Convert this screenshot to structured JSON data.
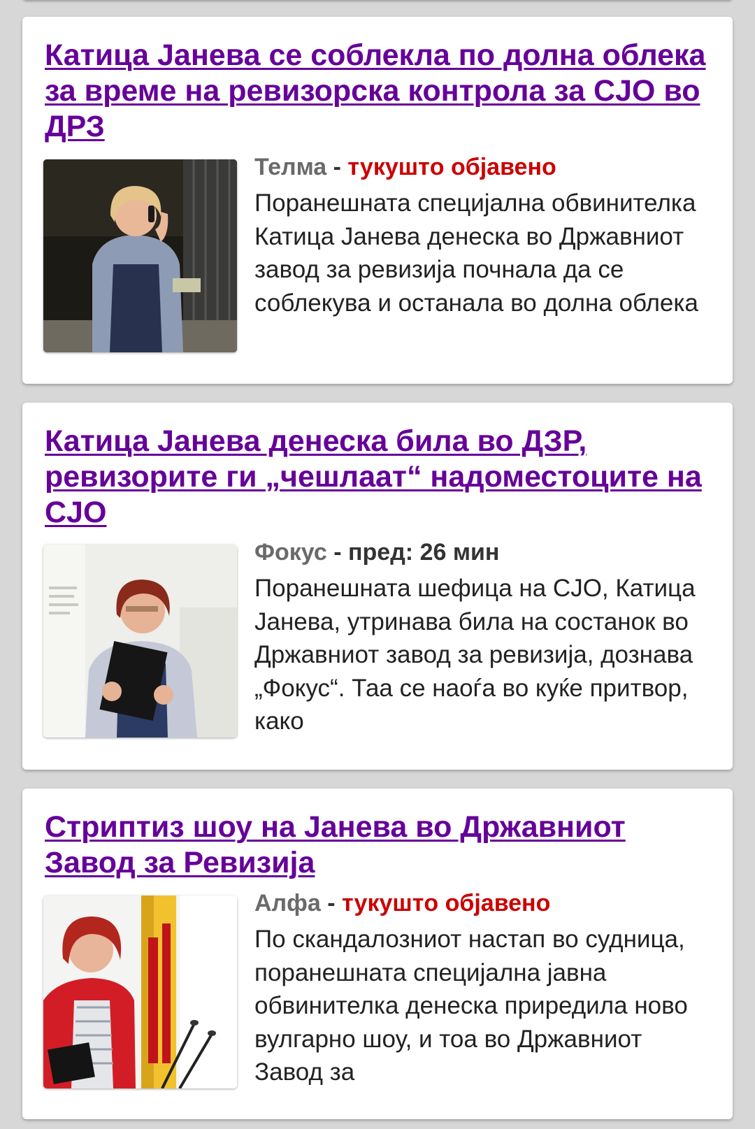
{
  "articles": [
    {
      "title": "Катица Јанева се соблекла по долна облека за време на ревизорска контрола за СЈО во ДРЗ",
      "source": "Телма",
      "separator": " - ",
      "time": "тукуштo објавено",
      "time_color": "#cc0000",
      "snippet": "Поранешната специјална обвинителка Катица Јанева денеска во Државниот завод за ревизија почнала да се соблекува и останала во долна облека"
    },
    {
      "title": "Катица Јанева денеска била во ДЗР, ревизорите ги „чешлаат“ надоместоците на СЈО",
      "source": "Фокус",
      "separator": " - ",
      "time": "пред: 26 мин",
      "time_color": "#333333",
      "snippet": "Поранешната шефица на СЈО, Катица Јанева, утринава била на состанок во Државниот завод за ревизија, дознава „Фокус“. Таа се наоѓа во куќе притвор, како"
    },
    {
      "title": "Стриптиз шоу на Јанева во Државниот Завод за Ревизија",
      "source": "Алфа",
      "separator": " - ",
      "time": "тукуштo објавено",
      "time_color": "#cc0000",
      "snippet": "По скандалозниот настап во судница, поранешната специјална јавна обвинителка денеска приредила ново вулгарно шоу, и тоа во Државниот Завод за"
    }
  ]
}
